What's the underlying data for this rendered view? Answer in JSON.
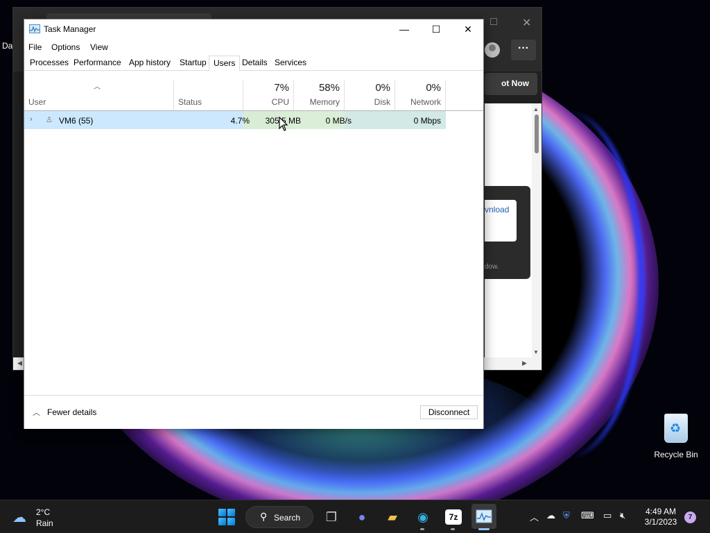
{
  "desktop": {
    "left_text": "Da",
    "recycle_bin_label": "Recycle Bin"
  },
  "background_window": {
    "not_now_label": "ot Now",
    "download_label": "vnload",
    "window_label": "dow.",
    "more_label": "···"
  },
  "task_manager": {
    "title": "Task Manager",
    "menu": [
      "File",
      "Options",
      "View"
    ],
    "tabs": [
      "Processes",
      "Performance",
      "App history",
      "Startup",
      "Users",
      "Details",
      "Services"
    ],
    "active_tab": "Users",
    "columns": {
      "user": {
        "label": "User"
      },
      "status": {
        "label": "Status"
      },
      "cpu": {
        "label": "CPU",
        "total": "7%"
      },
      "memory": {
        "label": "Memory",
        "total": "58%"
      },
      "disk": {
        "label": "Disk",
        "total": "0%"
      },
      "network": {
        "label": "Network",
        "total": "0%"
      }
    },
    "rows": [
      {
        "user": "VM6 (55)",
        "status": "",
        "cpu": "4.7%",
        "memory": "305.5 MB",
        "disk": "0 MB/s",
        "network": "0 Mbps"
      }
    ],
    "footer": {
      "fewer_details_label": "Fewer details",
      "disconnect_label": "Disconnect"
    },
    "colors": {
      "selection": "#cce8ff",
      "heat_light": "#fff4c4"
    }
  },
  "taskbar": {
    "weather": {
      "temp": "2°C",
      "condition": "Rain"
    },
    "search_label": "Search",
    "time": "4:49 AM",
    "date": "3/1/2023",
    "notification_count": "7",
    "pinned_apps": [
      "file-explorer-icon",
      "teams-chat-icon",
      "folder-icon",
      "edge-icon",
      "7zip-icon",
      "task-manager-icon"
    ],
    "seven_zip_label": "7z"
  }
}
